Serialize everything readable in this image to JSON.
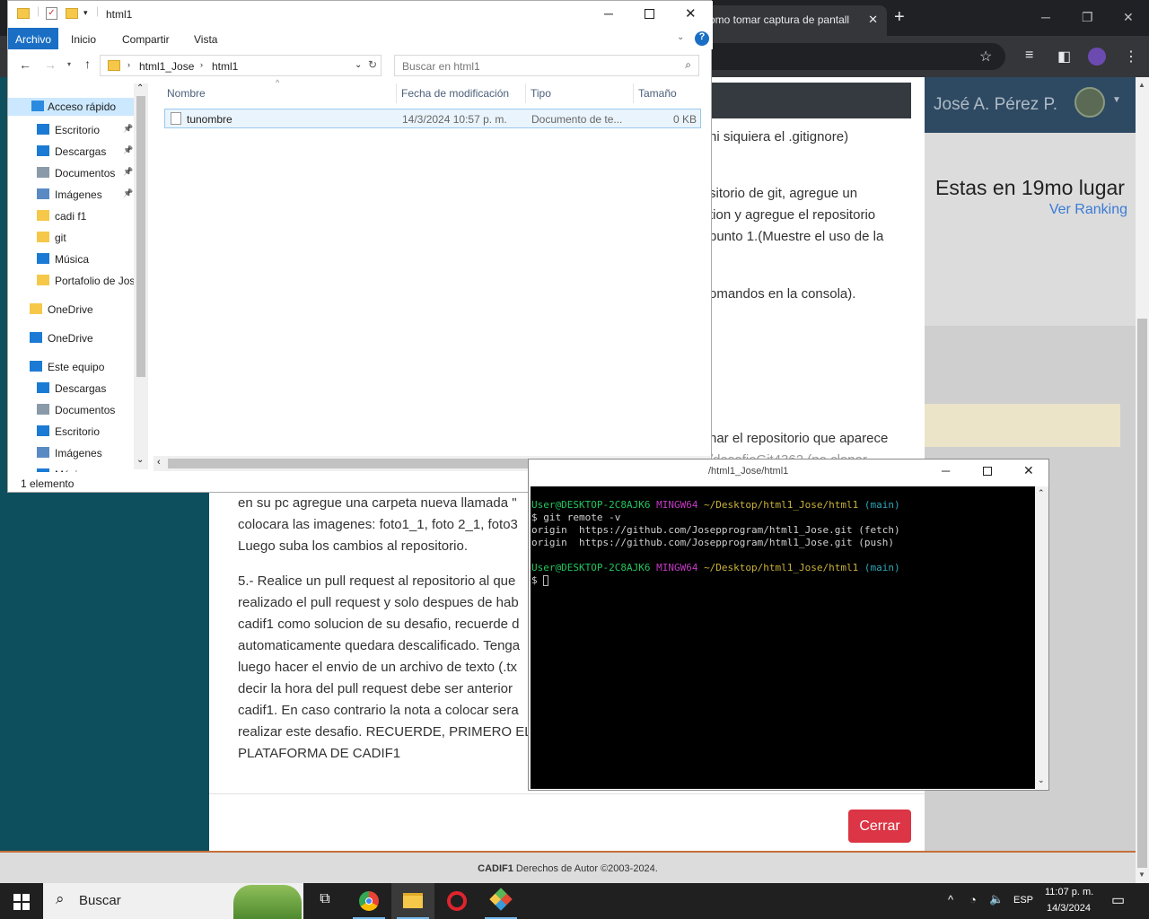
{
  "chrome": {
    "tab_title": "omo tomar captura de pantall",
    "tab_close": "✕",
    "new_tab": "+",
    "minimize": "─",
    "restore": "❐",
    "close": "✕"
  },
  "site": {
    "username": "José A. Pérez P.",
    "rank_title": "Estas en 19mo lugar",
    "rank_link": "Ver Ranking",
    "footer_brand": "CADIF1",
    "footer_text": " Derechos de Autor ©2003-2024."
  },
  "modal": {
    "lines_top": [
      "ni siquiera el .gitignore)",
      "sitorio de git, agregue un",
      "tion y agregue el repositorio",
      "punto 1.(Muestre el uso de la",
      "omandos en la consola).",
      "nar el repositorio que aparece",
      "/desafioGit4362 (no clonar"
    ],
    "lines_bottom": [
      "en su pc agregue una carpeta nueva llamada \"",
      "colocara las imagenes: foto1_1, foto 2_1, foto3",
      "Luego suba los cambios al repositorio.",
      "5.- Realice un pull request al repositorio al que",
      "realizado el pull request y solo despues de hab",
      "cadif1 como solucion de su desafio, recuerde d",
      "automaticamente quedara descalificado. Tenga",
      "luego hacer el envio de un archivo de texto (.tx",
      "decir la hora del pull request debe ser anterior",
      "cadif1. En caso contrario la nota a colocar sera",
      "realizar este desafio. RECUERDE, PRIMERO EL P",
      "PLATAFORMA DE CADIF1"
    ],
    "close_label": "Cerrar"
  },
  "explorer": {
    "title": "html1",
    "ribbon_tabs": [
      "Archivo",
      "Inicio",
      "Compartir",
      "Vista"
    ],
    "path": [
      "html1_Jose",
      "html1"
    ],
    "search_placeholder": "Buscar en html1",
    "nav_items": [
      {
        "label": "Acceso rápido",
        "icon": "star-icon",
        "color": "#2a8be0"
      },
      {
        "label": "Escritorio",
        "icon": "desktop-icon",
        "color": "#1b7bd4"
      },
      {
        "label": "Descargas",
        "icon": "download-icon",
        "color": "#1b7bd4"
      },
      {
        "label": "Documentos",
        "icon": "document-icon",
        "color": "#8a9aa8"
      },
      {
        "label": "Imágenes",
        "icon": "pictures-icon",
        "color": "#5a8ac4"
      },
      {
        "label": "cadi f1",
        "icon": "folder-icon",
        "color": "#f5c84a"
      },
      {
        "label": "git",
        "icon": "folder-icon",
        "color": "#f5c84a"
      },
      {
        "label": "Música",
        "icon": "music-icon",
        "color": "#1b7bd4"
      },
      {
        "label": "Portafolio de Jos",
        "icon": "folder-icon",
        "color": "#f5c84a"
      },
      {
        "label": "OneDrive",
        "icon": "folder-icon",
        "color": "#f5c84a"
      },
      {
        "label": "OneDrive",
        "icon": "cloud-icon",
        "color": "#1b7bd4"
      },
      {
        "label": "Este equipo",
        "icon": "computer-icon",
        "color": "#1b7bd4"
      },
      {
        "label": "Descargas",
        "icon": "download-icon",
        "color": "#1b7bd4"
      },
      {
        "label": "Documentos",
        "icon": "document-icon",
        "color": "#8a9aa8"
      },
      {
        "label": "Escritorio",
        "icon": "desktop-icon",
        "color": "#1b7bd4"
      },
      {
        "label": "Imágenes",
        "icon": "pictures-icon",
        "color": "#5a8ac4"
      },
      {
        "label": "Música",
        "icon": "music-icon",
        "color": "#1b7bd4"
      }
    ],
    "columns": [
      "Nombre",
      "Fecha de modificación",
      "Tipo",
      "Tamaño"
    ],
    "files": [
      {
        "name": "tunombre",
        "modified": "14/3/2024 10:57 p. m.",
        "type": "Documento de te...",
        "size": "0 KB"
      }
    ],
    "status": "1 elemento"
  },
  "gitbash": {
    "title": "/html1_Jose/html1",
    "prompt_user": "User@DESKTOP-2C8AJK6",
    "prompt_shell": "MINGW64",
    "prompt_path": "~/Desktop/html1_Jose/html1",
    "prompt_branch": "(main)",
    "command": "$ git remote -v",
    "out1": "origin  https://github.com/Josepprogram/html1_Jose.git (fetch)",
    "out2": "origin  https://github.com/Josepprogram/html1_Jose.git (push)",
    "cursor_prompt": "$"
  },
  "taskbar": {
    "search_label": "Buscar",
    "language": "ESP",
    "time": "11:07 p. m.",
    "date": "14/3/2024"
  }
}
